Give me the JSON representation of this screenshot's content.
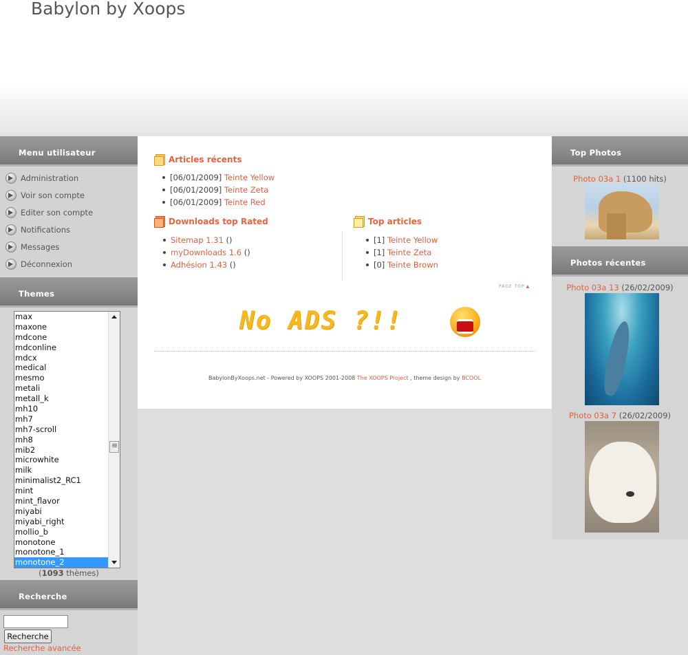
{
  "header": {
    "site_title": "Babylon by Xoops"
  },
  "left": {
    "user_menu": {
      "title": "Menu utilisateur",
      "items": [
        {
          "label": "Administration",
          "icon": "arrow-icon"
        },
        {
          "label": "Voir son compte",
          "icon": "arrow-icon"
        },
        {
          "label": "Editer son compte",
          "icon": "arrow-icon"
        },
        {
          "label": "Notifications",
          "icon": "arrow-icon"
        },
        {
          "label": "Messages",
          "icon": "arrow-icon"
        },
        {
          "label": "Déconnexion",
          "icon": "arrow-icon"
        }
      ]
    },
    "themes": {
      "title": "Themes",
      "options": [
        "max",
        "maxone",
        "mdcone",
        "mdconline",
        "mdcx",
        "medical",
        "mesmo",
        "metali",
        "metall_k",
        "mh10",
        "mh7",
        "mh7-scroll",
        "mh8",
        "mib2",
        "microwhite",
        "milk",
        "minimalist2_RC1",
        "mint",
        "mint_flavor",
        "miyabi",
        "miyabi_right",
        "mollio_b",
        "monotone",
        "monotone_1",
        "monotone_2"
      ],
      "selected": "monotone_2",
      "count": "1093",
      "count_suffix": " thèmes)",
      "count_prefix": "("
    },
    "search": {
      "title": "Recherche",
      "input_value": "",
      "button_label": "Recherche",
      "advanced_label": "Recherche avancée"
    }
  },
  "center": {
    "recent_articles": {
      "title": "Articles récents",
      "items": [
        {
          "date": "[06/01/2009]",
          "link": "Teinte Yellow"
        },
        {
          "date": "[06/01/2009]",
          "link": "Teinte Zeta"
        },
        {
          "date": "[06/01/2009]",
          "link": "Teinte Red"
        }
      ]
    },
    "downloads": {
      "title": "Downloads top Rated",
      "items": [
        {
          "link": "Sitemap 1.31",
          "suffix": " ()"
        },
        {
          "link": "myDownloads 1.6",
          "suffix": " ()"
        },
        {
          "link": "Adhésion 1.43",
          "suffix": " ()"
        }
      ]
    },
    "top_articles": {
      "title": "Top articles",
      "items": [
        {
          "count": "[1]",
          "link": "Teinte Yellow"
        },
        {
          "count": "[1]",
          "link": "Teinte Zeta"
        },
        {
          "count": "[0]",
          "link": "Teinte Brown"
        }
      ]
    },
    "page_top": "PAGE TOP",
    "banner_text": "No ADS ?!!",
    "footer": {
      "prefix": "BabylonByXoops.net - Powered by XOOPS 2001-2008 ",
      "xoops_link": "The XOOPS Project",
      "middle": " , theme design by ",
      "designer_link": "BCOOL"
    }
  },
  "right": {
    "top_photos": {
      "title": "Top Photos",
      "photo": {
        "link": "Photo 03a 1",
        "meta": " (1100 hits)"
      }
    },
    "recent_photos": {
      "title": "Photos récentes",
      "photos": [
        {
          "link": "Photo 03a 13",
          "meta": " (26/02/2009)"
        },
        {
          "link": "Photo 03a 7",
          "meta": " (26/02/2009)"
        }
      ]
    }
  },
  "colors": {
    "link": "#e06040",
    "title_bar": "#8c8c8c",
    "selection": "#3399ff"
  }
}
